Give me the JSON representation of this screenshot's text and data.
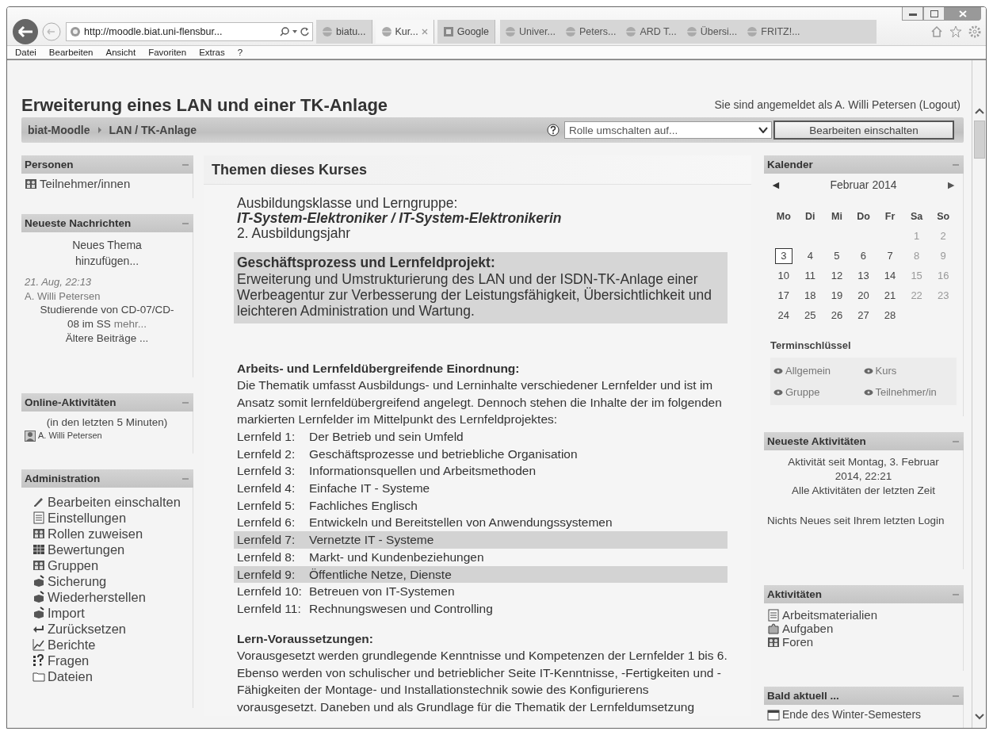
{
  "browser": {
    "address": "http://moodle.biat.uni-flensbur...",
    "tabs": [
      {
        "label": "biatu...",
        "selected": false
      },
      {
        "label": "Kur...",
        "selected": true
      },
      {
        "label": "Google",
        "selected": false
      }
    ],
    "favorites": [
      "Univer...",
      "Peters...",
      "ARD T...",
      "Übersi...",
      "FRITZ!..."
    ],
    "menu": [
      "Datei",
      "Bearbeiten",
      "Ansicht",
      "Favoriten",
      "Extras",
      "?"
    ]
  },
  "page": {
    "title": "Erweiterung eines LAN und einer TK-Anlage",
    "login_text": "Sie sind angemeldet als A. Willi Petersen",
    "logout_link": "(Logout)",
    "breadcrumb": [
      "biat-Moodle",
      "LAN / TK-Anlage"
    ],
    "role_select": {
      "placeholder": "Rolle umschalten auf..."
    },
    "edit_button": "Bearbeiten einschalten"
  },
  "left_blocks": {
    "people": {
      "title": "Personen",
      "items": [
        "Teilnehmer/innen"
      ]
    },
    "news": {
      "title": "Neueste Nachrichten",
      "add_link": "Neues Thema hinzufügen...",
      "posts": [
        {
          "date": "21. Aug, 22:13",
          "author": "A. Willi Petersen",
          "text": "Studierende von CD-07/CD-08 im SS",
          "more": "mehr..."
        }
      ],
      "older_link": "Ältere Beiträge ..."
    },
    "online": {
      "title": "Online-Aktivitäten",
      "note": "(in den letzten 5 Minuten)",
      "users": [
        "A. Willi Petersen"
      ]
    },
    "admin": {
      "title": "Administration",
      "items": [
        "Bearbeiten einschalten",
        "Einstellungen",
        "Rollen zuweisen",
        "Bewertungen",
        "Gruppen",
        "Sicherung",
        "Wiederherstellen",
        "Import",
        "Zurücksetzen",
        "Berichte",
        "Fragen",
        "Dateien"
      ]
    }
  },
  "course": {
    "heading": "Themen dieses Kurses",
    "intro_label": "Ausbildungsklasse und Lerngruppe:",
    "intro_group": "IT-System-Elektroniker / IT-System-Elektronikerin",
    "intro_year": "2. Ausbildungsjahr",
    "project": {
      "heading": "Geschäftsprozess und Lernfeldprojekt:",
      "text": "Erweiterung und Umstrukturierung des LAN und der ISDN-TK-Anlage einer Werbeagentur zur Verbesserung der Leistungsfähigkeit, Übersichtlichkeit und leichteren Administration und Wartung."
    },
    "classification": {
      "heading": "Arbeits- und Lernfeldübergreifende Einordnung:",
      "text": "Die Thematik umfasst Ausbildungs- und Lerninhalte verschiedener Lernfelder und ist im Ansatz somit lernfeldübergreifend angelegt. Dennoch stehen die Inhalte der im folgenden markierten Lernfelder im Mittelpunkt des Lernfeldprojektes:"
    },
    "lernfelder": [
      {
        "number": "Lernfeld 1:",
        "title": "Der Betrieb und sein Umfeld",
        "highlighted": false
      },
      {
        "number": "Lernfeld 2:",
        "title": "Geschäftsprozesse und betriebliche Organisation",
        "highlighted": false
      },
      {
        "number": "Lernfeld 3:",
        "title": "Informationsquellen und Arbeitsmethoden",
        "highlighted": false
      },
      {
        "number": "Lernfeld 4:",
        "title": "Einfache IT - Systeme",
        "highlighted": false
      },
      {
        "number": "Lernfeld 5:",
        "title": "Fachliches Englisch",
        "highlighted": false
      },
      {
        "number": "Lernfeld 6:",
        "title": "Entwickeln und Bereitstellen von Anwendungssystemen",
        "highlighted": false
      },
      {
        "number": "Lernfeld 7:",
        "title": "Vernetzte IT - Systeme",
        "highlighted": true
      },
      {
        "number": "Lernfeld 8:",
        "title": "Markt- und Kundenbeziehungen",
        "highlighted": false
      },
      {
        "number": "Lernfeld 9:",
        "title": "Öffentliche Netze, Dienste",
        "highlighted": true
      },
      {
        "number": "Lernfeld 10:",
        "title": "Betreuen von IT-Systemen",
        "highlighted": false
      },
      {
        "number": "Lernfeld 11:",
        "title": "Rechnungswesen und Controlling",
        "highlighted": false
      }
    ],
    "prerequisites": {
      "heading": "Lern-Voraussetzungen:",
      "text": "Vorausgesetzt werden grundlegende Kenntnisse und Kompetenzen der Lernfelder 1 bis 6. Ebenso werden von schulischer und betrieblicher Seite IT-Kenntnisse, -Fertigkeiten und -Fähigkeiten der Montage- und Installationstechnik sowie des Konfigurierens vorausgesetzt. Daneben und als Grundlage für die Thematik der Lernfeldumsetzung"
    }
  },
  "right_blocks": {
    "calendar": {
      "title": "Kalender",
      "prev": "◄",
      "month": "Februar 2014",
      "next": "►",
      "weekdays": [
        "Mo",
        "Di",
        "Mi",
        "Do",
        "Fr",
        "Sa",
        "So"
      ],
      "weeks": [
        {
          "padded_start": true,
          "days": [
            {
              "label": "1",
              "today": false,
              "weekend": true
            },
            {
              "label": "2",
              "today": false,
              "weekend": true
            }
          ]
        },
        {
          "padded_start": false,
          "days": [
            {
              "label": "3",
              "today": true,
              "weekend": false
            },
            {
              "label": "4",
              "today": false,
              "weekend": false
            },
            {
              "label": "5",
              "today": false,
              "weekend": false
            },
            {
              "label": "6",
              "today": false,
              "weekend": false
            },
            {
              "label": "7",
              "today": false,
              "weekend": false
            },
            {
              "label": "8",
              "today": false,
              "weekend": true
            },
            {
              "label": "9",
              "today": false,
              "weekend": true
            }
          ]
        },
        {
          "padded_start": false,
          "days": [
            {
              "label": "10",
              "today": false,
              "weekend": false
            },
            {
              "label": "11",
              "today": false,
              "weekend": false
            },
            {
              "label": "12",
              "today": false,
              "weekend": false
            },
            {
              "label": "13",
              "today": false,
              "weekend": false
            },
            {
              "label": "14",
              "today": false,
              "weekend": false
            },
            {
              "label": "15",
              "today": false,
              "weekend": true
            },
            {
              "label": "16",
              "today": false,
              "weekend": true
            }
          ]
        },
        {
          "padded_start": false,
          "days": [
            {
              "label": "17",
              "today": false,
              "weekend": false
            },
            {
              "label": "18",
              "today": false,
              "weekend": false
            },
            {
              "label": "19",
              "today": false,
              "weekend": false
            },
            {
              "label": "20",
              "today": false,
              "weekend": false
            },
            {
              "label": "21",
              "today": false,
              "weekend": false
            },
            {
              "label": "22",
              "today": false,
              "weekend": true
            },
            {
              "label": "23",
              "today": false,
              "weekend": true
            }
          ]
        },
        {
          "padded_start": false,
          "days": [
            {
              "label": "24",
              "today": false,
              "weekend": false
            },
            {
              "label": "25",
              "today": false,
              "weekend": false
            },
            {
              "label": "26",
              "today": false,
              "weekend": false
            },
            {
              "label": "27",
              "today": false,
              "weekend": false
            },
            {
              "label": "28",
              "today": false,
              "weekend": false
            }
          ]
        }
      ],
      "key_title": "Terminschlüssel",
      "key_items": [
        "Allgemein",
        "Kurs",
        "Gruppe",
        "Teilnehmer/in"
      ]
    },
    "recent": {
      "title": "Neueste Aktivitäten",
      "since": "Aktivität seit Montag, 3. Februar 2014, 22:21",
      "all_link": "Alle Aktivitäten der letzten Zeit",
      "nothing": "Nichts Neues seit Ihrem letzten Login"
    },
    "activities": {
      "title": "Aktivitäten",
      "items": [
        "Arbeitsmaterialien",
        "Aufgaben",
        "Foren"
      ]
    },
    "upcoming": {
      "title": "Bald aktuell ...",
      "items": [
        "Ende des Winter-Semesters"
      ]
    }
  }
}
